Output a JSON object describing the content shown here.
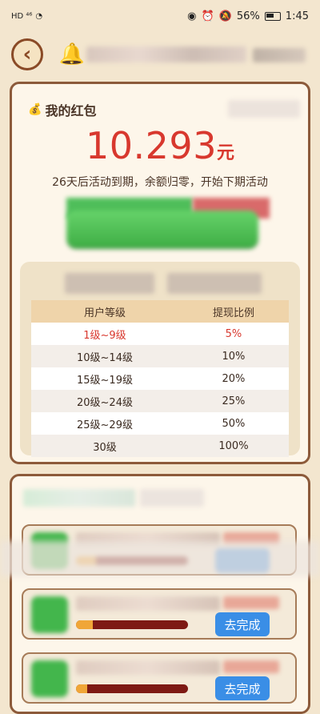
{
  "status_bar": {
    "network": "HD ⁴⁶",
    "battery_percent": "56%",
    "time": "1:45"
  },
  "wallet": {
    "title": "我的红包",
    "amount": "10.293",
    "unit": "元",
    "expiry_note": "26天后活动到期，余额归零，开始下期活动"
  },
  "ratio_table": {
    "headers": [
      "用户等级",
      "提现比例"
    ],
    "rows": [
      {
        "level": "1级~9级",
        "ratio": "5%"
      },
      {
        "level": "10级~14级",
        "ratio": "10%"
      },
      {
        "level": "15级~19级",
        "ratio": "20%"
      },
      {
        "level": "20级~24级",
        "ratio": "25%"
      },
      {
        "level": "25级~29级",
        "ratio": "50%"
      },
      {
        "level": "30级",
        "ratio": "100%"
      }
    ]
  },
  "tasks": [
    {
      "button_label": "",
      "progress_fraction": 0.18
    },
    {
      "button_label": "去完成",
      "progress_fraction": 0.15
    },
    {
      "button_label": "去完成",
      "progress_fraction": 0.1
    }
  ],
  "colors": {
    "accent_red": "#d8382e",
    "brand_brown": "#8c5a3a",
    "button_blue": "#3a8ee6",
    "button_green": "#4fbe5a"
  },
  "icons": {
    "back": "chevron-left-icon",
    "bell": "bell-icon",
    "moneybag": "moneybag-icon"
  }
}
